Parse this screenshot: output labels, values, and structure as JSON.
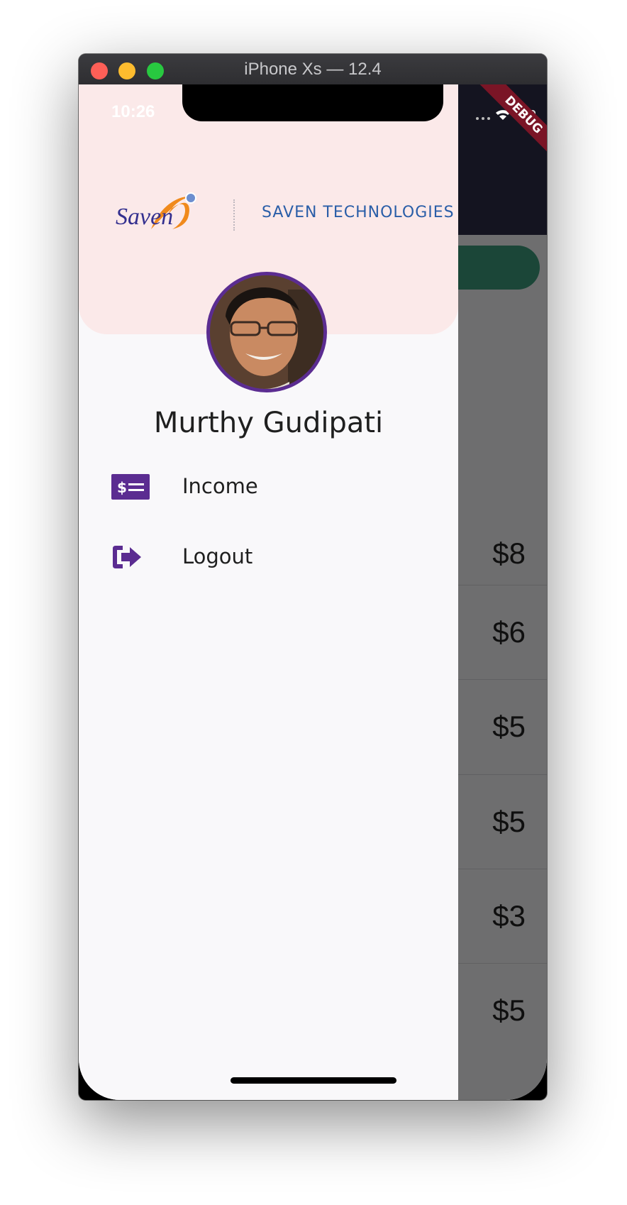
{
  "window": {
    "title": "iPhone Xs — 12.4"
  },
  "status_bar": {
    "time": "10:26"
  },
  "debug_banner": "DEBUG",
  "drawer": {
    "logo_text": "Saven",
    "company_name": "SAVEN TECHNOLOGIES",
    "user_name": "Murthy Gudipati",
    "menu": [
      {
        "label": "Income",
        "icon": "income-icon"
      },
      {
        "label": "Logout",
        "icon": "logout-icon"
      }
    ]
  },
  "background_list": {
    "amounts": [
      "$8",
      "$6",
      "$5",
      "$5",
      "$3",
      "$5"
    ]
  },
  "colors": {
    "accent": "#5b2c91",
    "header_bg": "#fbe9e9",
    "app_bar": "#2e2d48",
    "green_button": "#3c9c7c"
  }
}
